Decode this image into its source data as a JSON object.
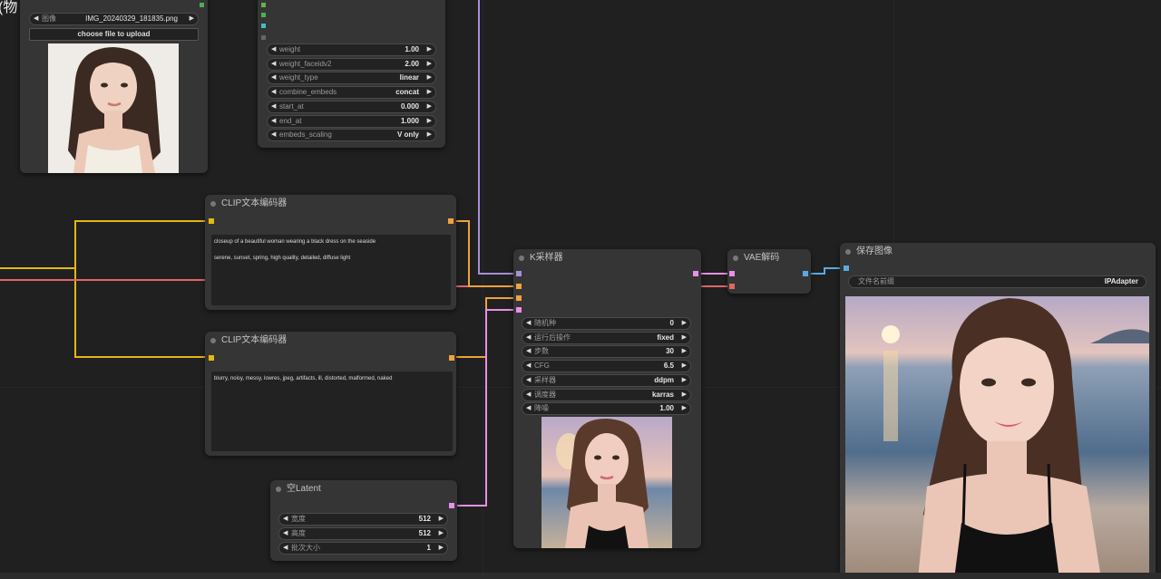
{
  "corner_fragment": "(物",
  "load_image_node": {
    "image_widget": {
      "name": "图像",
      "value": "IMG_20240329_181835.png"
    },
    "upload_button": "choose file to upload"
  },
  "ipadapter_node": {
    "widgets": [
      {
        "name": "weight",
        "value": "1.00"
      },
      {
        "name": "weight_faceidv2",
        "value": "2.00"
      },
      {
        "name": "weight_type",
        "value": "linear"
      },
      {
        "name": "combine_embeds",
        "value": "concat"
      },
      {
        "name": "start_at",
        "value": "0.000"
      },
      {
        "name": "end_at",
        "value": "1.000"
      },
      {
        "name": "embeds_scaling",
        "value": "V only"
      }
    ]
  },
  "clip_positive": {
    "title": "CLIP文本编码器",
    "text": "closeup of a beautiful woman wearing a black dress on the seaside\n\nserene, sunset, spring, high quality, detailed, diffuse light"
  },
  "clip_negative": {
    "title": "CLIP文本编码器",
    "text": "blurry, noisy, messy, lowres, jpeg, artifacts, ill, distorted, malformed, naked"
  },
  "empty_latent": {
    "title": "空Latent",
    "widgets": [
      {
        "name": "宽度",
        "value": "512"
      },
      {
        "name": "高度",
        "value": "512"
      },
      {
        "name": "批次大小",
        "value": "1"
      }
    ]
  },
  "ksampler": {
    "title": "K采样器",
    "widgets": [
      {
        "name": "随机种",
        "value": "0"
      },
      {
        "name": "运行后操作",
        "value": "fixed"
      },
      {
        "name": "步数",
        "value": "30"
      },
      {
        "name": "CFG",
        "value": "6.5"
      },
      {
        "name": "采样器",
        "value": "ddpm"
      },
      {
        "name": "调度器",
        "value": "karras"
      },
      {
        "name": "降噪",
        "value": "1.00"
      }
    ]
  },
  "vae_decode": {
    "title": "VAE解码"
  },
  "save_image": {
    "title": "保存图像",
    "widget": {
      "name": "文件名前缀",
      "value": "IPAdapter"
    }
  },
  "colors": {
    "background": "#202020",
    "node": "#353535",
    "clip_wire": "#e6b711",
    "conditioning_wire": "#f0a23c",
    "model_wire": "#b39ddb",
    "vae_wire": "#ff6e6e",
    "latent_wire": "#ff9cf9",
    "image_wire": "#64b5f6"
  }
}
